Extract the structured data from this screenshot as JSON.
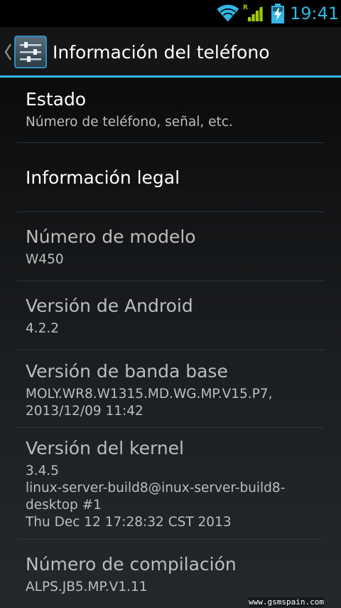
{
  "status_bar": {
    "time": "19:41",
    "roaming_indicator": "R",
    "icons": [
      "wifi-icon",
      "signal-icon",
      "battery-charging-icon"
    ],
    "accent_color": "#33b5e5"
  },
  "action_bar": {
    "title": "Información del teléfono",
    "icons": [
      "chevron-left-icon",
      "settings-sliders-icon"
    ]
  },
  "items": [
    {
      "title": "Estado",
      "summary": "Número de teléfono, señal, etc."
    },
    {
      "title": "Información legal",
      "summary": ""
    },
    {
      "title": "Número de modelo",
      "summary": "W450"
    },
    {
      "title": "Versión de Android",
      "summary": "4.2.2"
    },
    {
      "title": "Versión de banda base",
      "summary": "MOLY.WR8.W1315.MD.WG.MP.V15.P7,\n2013/12/09 11:42"
    },
    {
      "title": "Versión del kernel",
      "summary": "3.4.5\nlinux-server-build8@inux-server-build8-\ndesktop #1\nThu Dec 12 17:28:32 CST 2013"
    },
    {
      "title": "Número de compilación",
      "summary": "ALPS.JB5.MP.V1.11"
    }
  ],
  "watermark": "www.gsmspain.com"
}
